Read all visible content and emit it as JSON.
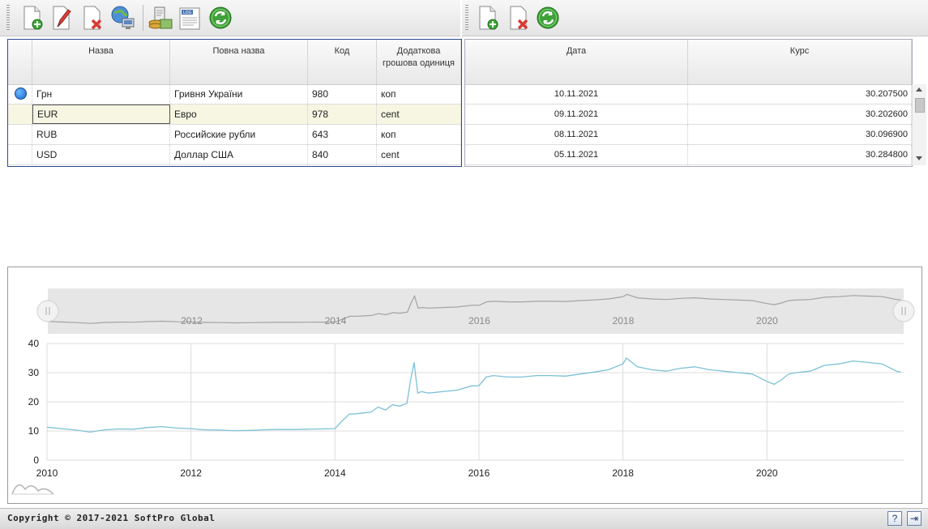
{
  "toolbar_left": {
    "buttons": [
      {
        "name": "add-button",
        "icon": "document-add-icon"
      },
      {
        "name": "edit-button",
        "icon": "document-edit-icon"
      },
      {
        "name": "delete-button",
        "icon": "document-delete-icon"
      },
      {
        "name": "network-update-button",
        "icon": "globe-network-icon"
      },
      {
        "name": "rates-button",
        "icon": "money-coins-icon"
      },
      {
        "name": "log-button",
        "icon": "log-document-icon"
      },
      {
        "name": "refresh-button",
        "icon": "refresh-icon"
      }
    ]
  },
  "toolbar_right": {
    "buttons": [
      {
        "name": "add-rate-button",
        "icon": "document-add-icon"
      },
      {
        "name": "delete-rate-button",
        "icon": "document-delete-icon"
      },
      {
        "name": "refresh-rates-button",
        "icon": "refresh-icon"
      }
    ]
  },
  "currencies": {
    "columns": [
      "Назва",
      "Повна назва",
      "Код",
      "Додаткова грошова одиниця"
    ],
    "rows": [
      {
        "name": "Грн",
        "full_name": "Гривня України",
        "code": "980",
        "sub_unit": "коп",
        "current": true
      },
      {
        "name": "EUR",
        "full_name": "Евро",
        "code": "978",
        "sub_unit": "cent",
        "selected": true
      },
      {
        "name": "RUB",
        "full_name": "Российские рубли",
        "code": "643",
        "sub_unit": "коп"
      },
      {
        "name": "USD",
        "full_name": "Доллар США",
        "code": "840",
        "sub_unit": "cent"
      }
    ]
  },
  "rates": {
    "columns": [
      "Дата",
      "Курс"
    ],
    "rows": [
      {
        "date": "10.11.2021",
        "rate": "30.207500"
      },
      {
        "date": "09.11.2021",
        "rate": "30.202600"
      },
      {
        "date": "08.11.2021",
        "rate": "30.096900"
      },
      {
        "date": "05.11.2021",
        "rate": "30.284800"
      }
    ]
  },
  "chart_data": {
    "type": "line",
    "title": "",
    "xlabel": "",
    "ylabel": "",
    "xlim": [
      2010,
      2021.9
    ],
    "ylim": [
      0,
      40
    ],
    "yticks": [
      0,
      10,
      20,
      30,
      40
    ],
    "xticks": [
      2010,
      2012,
      2014,
      2016,
      2018,
      2020
    ],
    "navigator_xticks": [
      2012,
      2014,
      2016,
      2018,
      2020
    ],
    "grid": true,
    "series": [
      {
        "color": "#7cc1d6",
        "x": [
          2010.0,
          2010.2,
          2010.4,
          2010.6,
          2010.8,
          2011.0,
          2011.2,
          2011.4,
          2011.6,
          2011.8,
          2012.0,
          2012.2,
          2012.4,
          2012.6,
          2012.8,
          2013.0,
          2013.2,
          2013.4,
          2013.6,
          2013.8,
          2014.0,
          2014.1,
          2014.2,
          2014.3,
          2014.4,
          2014.5,
          2014.6,
          2014.7,
          2014.8,
          2014.9,
          2015.0,
          2015.05,
          2015.1,
          2015.12,
          2015.15,
          2015.2,
          2015.3,
          2015.5,
          2015.7,
          2015.9,
          2016.0,
          2016.1,
          2016.2,
          2016.4,
          2016.6,
          2016.8,
          2017.0,
          2017.2,
          2017.4,
          2017.6,
          2017.8,
          2018.0,
          2018.05,
          2018.2,
          2018.4,
          2018.6,
          2018.8,
          2019.0,
          2019.2,
          2019.4,
          2019.6,
          2019.8,
          2020.0,
          2020.1,
          2020.2,
          2020.3,
          2020.4,
          2020.6,
          2020.8,
          2021.0,
          2021.2,
          2021.4,
          2021.6,
          2021.8,
          2021.86
        ],
        "y": [
          11.3,
          10.8,
          10.3,
          9.6,
          10.4,
          10.7,
          10.6,
          11.2,
          11.5,
          11.0,
          10.8,
          10.4,
          10.3,
          10.1,
          10.2,
          10.4,
          10.5,
          10.5,
          10.6,
          10.7,
          10.8,
          13.5,
          15.8,
          15.9,
          16.2,
          16.5,
          18.2,
          17.2,
          19.0,
          18.5,
          19.5,
          27.5,
          33.5,
          29.0,
          23.0,
          23.5,
          23.0,
          23.5,
          24.0,
          25.5,
          25.5,
          28.5,
          29.0,
          28.5,
          28.5,
          29.0,
          29.0,
          28.8,
          29.5,
          30.2,
          31.0,
          33.0,
          35.0,
          32.0,
          31.0,
          30.5,
          31.5,
          32.0,
          31.0,
          30.5,
          30.0,
          29.5,
          27.0,
          26.0,
          27.5,
          29.5,
          30.0,
          30.5,
          32.5,
          33.0,
          34.0,
          33.5,
          33.0,
          30.5,
          30.2
        ]
      }
    ]
  },
  "footer": {
    "copyright": "Copyright © 2017-2021 SoftPro Global",
    "help_label": "?",
    "exit_label": "⇥"
  }
}
